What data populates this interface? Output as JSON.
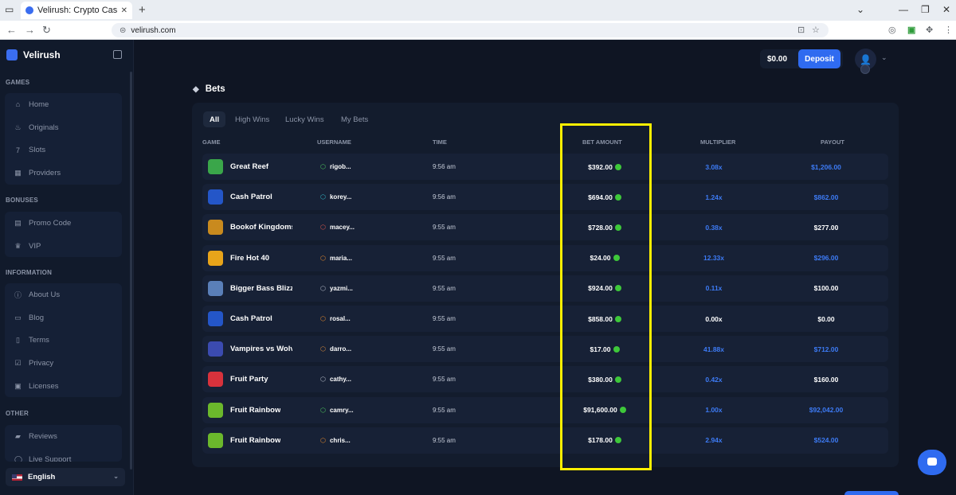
{
  "browser": {
    "tab_title": "Velirush: Crypto Casino Games",
    "tab_close": "✕",
    "new_tab": "+",
    "url": "velirush.com"
  },
  "sidebar": {
    "brand": "Velirush",
    "sections": [
      {
        "label": "GAMES",
        "items": [
          {
            "label": "Home",
            "icon": "home-icon"
          },
          {
            "label": "Originals",
            "icon": "flame-icon"
          },
          {
            "label": "Slots",
            "icon": "slots-icon"
          },
          {
            "label": "Providers",
            "icon": "grid-icon"
          }
        ]
      },
      {
        "label": "BONUSES",
        "items": [
          {
            "label": "Promo Code",
            "icon": "ticket-icon"
          },
          {
            "label": "VIP",
            "icon": "crown-icon"
          }
        ]
      },
      {
        "label": "INFORMATION",
        "items": [
          {
            "label": "About Us",
            "icon": "info-icon"
          },
          {
            "label": "Blog",
            "icon": "blog-icon"
          },
          {
            "label": "Terms",
            "icon": "document-icon"
          },
          {
            "label": "Privacy",
            "icon": "shield-check-icon"
          },
          {
            "label": "Licenses",
            "icon": "license-icon"
          }
        ]
      },
      {
        "label": "OTHER",
        "items": [
          {
            "label": "Reviews",
            "icon": "chat-icon"
          },
          {
            "label": "Live Support",
            "icon": "headset-icon"
          }
        ]
      }
    ],
    "language": "English"
  },
  "header": {
    "balance": "$0.00",
    "deposit_label": "Deposit"
  },
  "bets": {
    "title": "Bets",
    "tabs": [
      "All",
      "High Wins",
      "Lucky Wins",
      "My Bets"
    ],
    "active_tab": "All",
    "columns": [
      "GAME",
      "USERNAME",
      "TIME",
      "BET AMOUNT",
      "MULTIPLIER",
      "PAYOUT"
    ],
    "rows": [
      {
        "game": "Great Reef",
        "thumb_color": "#3aa64a",
        "user": "rigob...",
        "user_color": "#4ec95e",
        "time": "9:56 am",
        "bet": "$392.00",
        "mult": "3.08x",
        "mult_color": "#3d7bf5",
        "payout": "$1,206.00",
        "payout_color": "#3d7bf5"
      },
      {
        "game": "Cash Patrol",
        "thumb_color": "#2456c8",
        "user": "korey...",
        "user_color": "#33b9c9",
        "time": "9:56 am",
        "bet": "$694.00",
        "mult": "1.24x",
        "mult_color": "#3d7bf5",
        "payout": "$862.00",
        "payout_color": "#3d7bf5"
      },
      {
        "game": "Bookof Kingdoms",
        "thumb_color": "#c98a1e",
        "user": "macey...",
        "user_color": "#e2574c",
        "time": "9:55 am",
        "bet": "$728.00",
        "mult": "0.38x",
        "mult_color": "#3d7bf5",
        "payout": "$277.00",
        "payout_color": "#ffffff"
      },
      {
        "game": "Fire Hot 40",
        "thumb_color": "#e8a41a",
        "user": "maria...",
        "user_color": "#e58a2e",
        "time": "9:55 am",
        "bet": "$24.00",
        "mult": "12.33x",
        "mult_color": "#3d7bf5",
        "payout": "$296.00",
        "payout_color": "#3d7bf5"
      },
      {
        "game": "Bigger Bass Blizzard",
        "thumb_color": "#5a7fb8",
        "user": "yazmi...",
        "user_color": "#b5bcc9",
        "time": "9:55 am",
        "bet": "$924.00",
        "mult": "0.11x",
        "mult_color": "#3d7bf5",
        "payout": "$100.00",
        "payout_color": "#ffffff"
      },
      {
        "game": "Cash Patrol",
        "thumb_color": "#2456c8",
        "user": "rosal...",
        "user_color": "#e58a2e",
        "time": "9:55 am",
        "bet": "$858.00",
        "mult": "0.00x",
        "mult_color": "#ffffff",
        "payout": "$0.00",
        "payout_color": "#ffffff"
      },
      {
        "game": "Vampires vs Wolves",
        "thumb_color": "#3b4bb0",
        "user": "darro...",
        "user_color": "#d98a3a",
        "time": "9:55 am",
        "bet": "$17.00",
        "mult": "41.88x",
        "mult_color": "#3d7bf5",
        "payout": "$712.00",
        "payout_color": "#3d7bf5"
      },
      {
        "game": "Fruit Party",
        "thumb_color": "#d8323c",
        "user": "cathy...",
        "user_color": "#b5bcc9",
        "time": "9:55 am",
        "bet": "$380.00",
        "mult": "0.42x",
        "mult_color": "#3d7bf5",
        "payout": "$160.00",
        "payout_color": "#ffffff"
      },
      {
        "game": "Fruit Rainbow",
        "thumb_color": "#6bb82c",
        "user": "camry...",
        "user_color": "#4ec95e",
        "time": "9:55 am",
        "bet": "$91,600.00",
        "mult": "1.00x",
        "mult_color": "#3d7bf5",
        "payout": "$92,042.00",
        "payout_color": "#3d7bf5"
      },
      {
        "game": "Fruit Rainbow",
        "thumb_color": "#6bb82c",
        "user": "chris...",
        "user_color": "#e58a2e",
        "time": "9:55 am",
        "bet": "$178.00",
        "mult": "2.94x",
        "mult_color": "#3d7bf5",
        "payout": "$524.00",
        "payout_color": "#3d7bf5"
      }
    ]
  }
}
